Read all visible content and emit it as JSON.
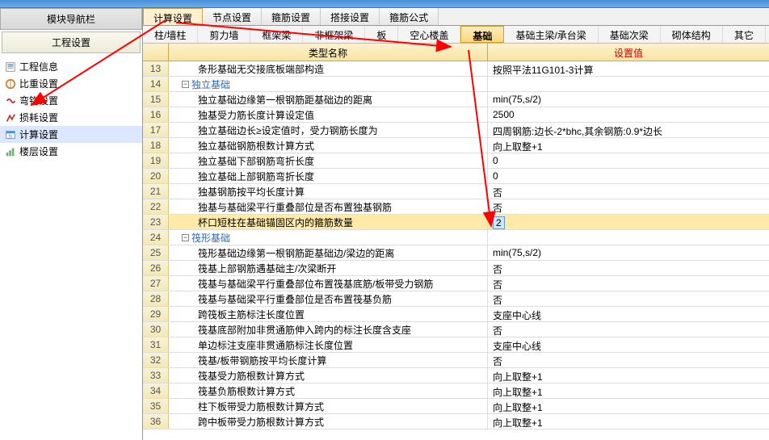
{
  "sidebar": {
    "title": "模块导航栏",
    "projectSettings": "工程设置",
    "items": [
      {
        "label": "工程信息"
      },
      {
        "label": "比重设置"
      },
      {
        "label": "弯钩设置"
      },
      {
        "label": "损耗设置"
      },
      {
        "label": "计算设置"
      },
      {
        "label": "楼层设置"
      }
    ]
  },
  "topTabs": [
    "计算设置",
    "节点设置",
    "箍筋设置",
    "搭接设置",
    "箍筋公式"
  ],
  "subTabs": [
    "柱/墙柱",
    "剪力墙",
    "框架梁",
    "非框架梁",
    "板",
    "空心楼盖",
    "基础",
    "基础主梁/承台梁",
    "基础次梁",
    "砌体结构",
    "其它"
  ],
  "headers": {
    "name": "类型名称",
    "value": "设置值"
  },
  "rows": [
    {
      "n": 13,
      "ind": 2,
      "name": "条形基础无交接底板端部构造",
      "val": "按照平法11G101-3计算"
    },
    {
      "n": 14,
      "ind": 0,
      "section": true,
      "name": "独立基础",
      "val": ""
    },
    {
      "n": 15,
      "ind": 2,
      "name": "独立基础边缘第一根钢筋距基础边的距离",
      "val": "min(75,s/2)"
    },
    {
      "n": 16,
      "ind": 2,
      "name": "独基受力筋长度计算设定值",
      "val": "2500"
    },
    {
      "n": 17,
      "ind": 2,
      "name": "独立基础边长≥设定值时，受力钢筋长度为",
      "val": "四周钢筋:边长-2*bhc,其余钢筋:0.9*边长"
    },
    {
      "n": 18,
      "ind": 2,
      "name": "独立基础钢筋根数计算方式",
      "val": "向上取整+1"
    },
    {
      "n": 19,
      "ind": 2,
      "name": "独立基础下部钢筋弯折长度",
      "val": "0"
    },
    {
      "n": 20,
      "ind": 2,
      "name": "独立基础上部钢筋弯折长度",
      "val": "0"
    },
    {
      "n": 21,
      "ind": 2,
      "name": "独基钢筋按平均长度计算",
      "val": "否"
    },
    {
      "n": 22,
      "ind": 2,
      "name": "独基与基础梁平行重叠部位是否布置独基钢筋",
      "val": "否"
    },
    {
      "n": 23,
      "ind": 2,
      "sel": true,
      "name": "杯口短柱在基础锚固区内的箍筋数量",
      "val": "2",
      "editing": true
    },
    {
      "n": 24,
      "ind": 0,
      "section": true,
      "name": "筏形基础",
      "val": ""
    },
    {
      "n": 25,
      "ind": 2,
      "name": "筏形基础边缘第一根钢筋距基础边/梁边的距离",
      "val": "min(75,s/2)"
    },
    {
      "n": 26,
      "ind": 2,
      "name": "筏基上部钢筋遇基础主/次梁断开",
      "val": "否"
    },
    {
      "n": 27,
      "ind": 2,
      "name": "筏基与基础梁平行重叠部位布置筏基底筋/板带受力钢筋",
      "val": "否"
    },
    {
      "n": 28,
      "ind": 2,
      "name": "筏基与基础梁平行重叠部位是否布置筏基负筋",
      "val": "否"
    },
    {
      "n": 29,
      "ind": 2,
      "name": "跨筏板主筋标注长度位置",
      "val": "支座中心线"
    },
    {
      "n": 30,
      "ind": 2,
      "name": "筏基底部附加非贯通筋伸入跨内的标注长度含支座",
      "val": "否"
    },
    {
      "n": 31,
      "ind": 2,
      "name": "单边标注支座非贯通筋标注长度位置",
      "val": "支座中心线"
    },
    {
      "n": 32,
      "ind": 2,
      "name": "筏基/板带钢筋按平均长度计算",
      "val": "否"
    },
    {
      "n": 33,
      "ind": 2,
      "name": "筏基受力筋根数计算方式",
      "val": "向上取整+1"
    },
    {
      "n": 34,
      "ind": 2,
      "name": "筏基负筋根数计算方式",
      "val": "向上取整+1"
    },
    {
      "n": 35,
      "ind": 2,
      "name": "柱下板带受力筋根数计算方式",
      "val": "向上取整+1"
    },
    {
      "n": 36,
      "ind": 2,
      "name": "跨中板带受力筋根数计算方式",
      "val": "向上取整+1"
    }
  ]
}
